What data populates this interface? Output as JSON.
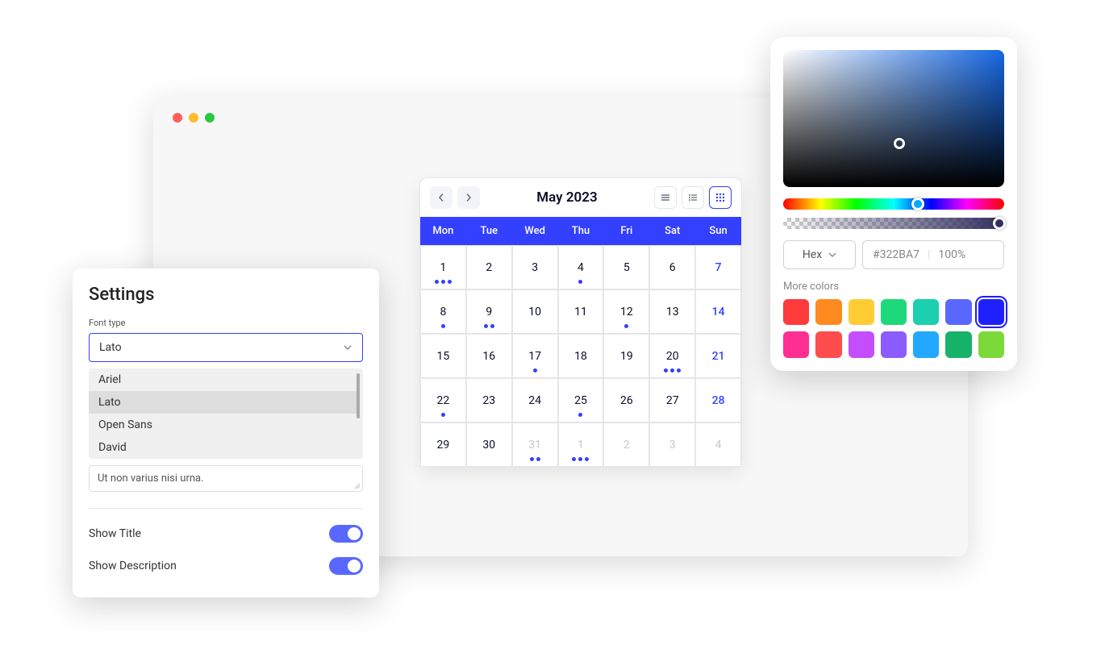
{
  "calendar": {
    "title": "May 2023",
    "dow": [
      "Mon",
      "Tue",
      "Wed",
      "Thu",
      "Fri",
      "Sat",
      "Sun"
    ],
    "cells": [
      {
        "n": "1",
        "dots": 3
      },
      {
        "n": "2"
      },
      {
        "n": "3"
      },
      {
        "n": "4",
        "dots": 1
      },
      {
        "n": "5"
      },
      {
        "n": "6"
      },
      {
        "n": "7",
        "sunday": true
      },
      {
        "n": "8",
        "dots": 1
      },
      {
        "n": "9",
        "dots": 2
      },
      {
        "n": "10"
      },
      {
        "n": "11"
      },
      {
        "n": "12",
        "dots": 1
      },
      {
        "n": "13"
      },
      {
        "n": "14",
        "sunday": true
      },
      {
        "n": "15"
      },
      {
        "n": "16"
      },
      {
        "n": "17",
        "dots": 1
      },
      {
        "n": "18"
      },
      {
        "n": "19"
      },
      {
        "n": "20",
        "dots": 3
      },
      {
        "n": "21",
        "sunday": true
      },
      {
        "n": "22",
        "dots": 1
      },
      {
        "n": "23"
      },
      {
        "n": "24"
      },
      {
        "n": "25",
        "dots": 1
      },
      {
        "n": "26"
      },
      {
        "n": "27"
      },
      {
        "n": "28",
        "sunday": true
      },
      {
        "n": "29"
      },
      {
        "n": "30"
      },
      {
        "n": "31",
        "dots": 2,
        "other": true
      },
      {
        "n": "1",
        "dots": 3,
        "other": true
      },
      {
        "n": "2",
        "other": true
      },
      {
        "n": "3",
        "other": true
      },
      {
        "n": "4",
        "other": true
      }
    ]
  },
  "settings": {
    "title": "Settings",
    "font_label": "Font type",
    "font_value": "Lato",
    "options": [
      "Ariel",
      "Lato",
      "Open Sans",
      "David"
    ],
    "textarea_value": "Ut non varius nisi urna.",
    "show_title_label": "Show Title",
    "show_description_label": "Show Description"
  },
  "picker": {
    "format": "Hex",
    "hex": "#322BA7",
    "opacity": "100%",
    "more_label": "More colors",
    "swatches": [
      "#ff3b3b",
      "#ff8a1f",
      "#ffcc33",
      "#1ed97c",
      "#1ccfae",
      "#5868ff",
      "#2020ff",
      "#ff2e93",
      "#ff4d4d",
      "#c34dff",
      "#8b5cff",
      "#22a8ff",
      "#17b26a",
      "#7bd939"
    ],
    "selected_swatch_index": 6
  }
}
